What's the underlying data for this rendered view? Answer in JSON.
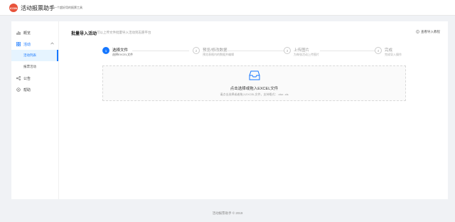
{
  "header": {
    "logo_text": "ICON",
    "app_title": "活动报票助手",
    "subtitle": "一个超好用的报票工具"
  },
  "sidebar": {
    "items": [
      {
        "label": "概览",
        "icon": "bar-chart-icon"
      },
      {
        "label": "活动",
        "icon": "grid-icon",
        "expanded": true,
        "children": [
          {
            "label": "活动列表",
            "active": true
          },
          {
            "label": "报票活动"
          }
        ]
      },
      {
        "label": "公告",
        "icon": "share-icon"
      },
      {
        "label": "帮助",
        "icon": "gear-icon"
      }
    ]
  },
  "main": {
    "title": "批量导入活动",
    "description": "可以上传文件批量导入活动到志愿平台",
    "help_link": "查看导入教程"
  },
  "steps": [
    {
      "number": "1",
      "title": "选择文件",
      "desc": "选择EXCEL文件",
      "active": true
    },
    {
      "number": "2",
      "title": "预览/修改数据",
      "desc": "预览表格内的数据并编辑",
      "active": false
    },
    {
      "number": "3",
      "title": "上传图片",
      "desc": "为每张活动上传图片",
      "active": false
    },
    {
      "number": "4",
      "title": "完成",
      "desc": "完成导入操作",
      "active": false
    }
  ],
  "upload": {
    "main_text": "点击选择或拖入EXCEL文件",
    "hint": "请点击选择或者拖入EXCEL文件，支持格式：.xlsx .xls"
  },
  "footer": {
    "text": "活动报票助手 © 2019"
  },
  "colors": {
    "accent": "#1677ff",
    "logo": "#e8533b",
    "background": "#f0f2f5"
  }
}
